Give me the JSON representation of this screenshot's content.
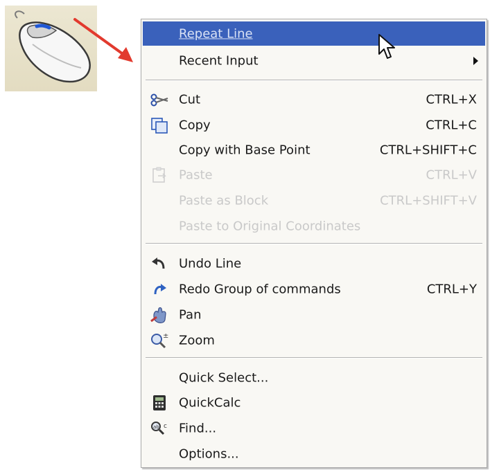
{
  "colors": {
    "highlight": "#3a61bb",
    "menu_background": "#f9f8f4",
    "disabled_text": "#c9c9c9",
    "arrow": "#e23a2e"
  },
  "illustration": {
    "image": "mouse-right-click-icon",
    "arrow": "red-pointer-arrow"
  },
  "menu": {
    "items": [
      {
        "label": "Repeat Line",
        "shortcut": "",
        "icon": "",
        "state": "highlighted"
      },
      {
        "label": "Recent Input",
        "shortcut": "",
        "icon": "",
        "state": "enabled",
        "submenu": true
      },
      {
        "label": "Cut",
        "shortcut": "CTRL+X",
        "icon": "scissors-icon",
        "state": "enabled"
      },
      {
        "label": "Copy",
        "shortcut": "CTRL+C",
        "icon": "copy-icon",
        "state": "enabled"
      },
      {
        "label": "Copy with Base Point",
        "shortcut": "CTRL+SHIFT+C",
        "icon": "",
        "state": "enabled"
      },
      {
        "label": "Paste",
        "shortcut": "CTRL+V",
        "icon": "paste-icon",
        "state": "disabled"
      },
      {
        "label": "Paste as Block",
        "shortcut": "CTRL+SHIFT+V",
        "icon": "",
        "state": "disabled"
      },
      {
        "label": "Paste to Original Coordinates",
        "shortcut": "",
        "icon": "",
        "state": "disabled"
      },
      {
        "label": "Undo Line",
        "shortcut": "",
        "icon": "undo-icon",
        "state": "enabled"
      },
      {
        "label": "Redo Group of commands",
        "shortcut": "CTRL+Y",
        "icon": "redo-icon",
        "state": "enabled"
      },
      {
        "label": "Pan",
        "shortcut": "",
        "icon": "pan-hand-icon",
        "state": "enabled"
      },
      {
        "label": "Zoom",
        "shortcut": "",
        "icon": "zoom-icon",
        "state": "enabled"
      },
      {
        "label": "Quick Select...",
        "shortcut": "",
        "icon": "",
        "state": "enabled"
      },
      {
        "label": "QuickCalc",
        "shortcut": "",
        "icon": "calculator-icon",
        "state": "enabled"
      },
      {
        "label": "Find...",
        "shortcut": "",
        "icon": "find-icon",
        "state": "enabled"
      },
      {
        "label": "Options...",
        "shortcut": "",
        "icon": "",
        "state": "enabled"
      }
    ]
  }
}
